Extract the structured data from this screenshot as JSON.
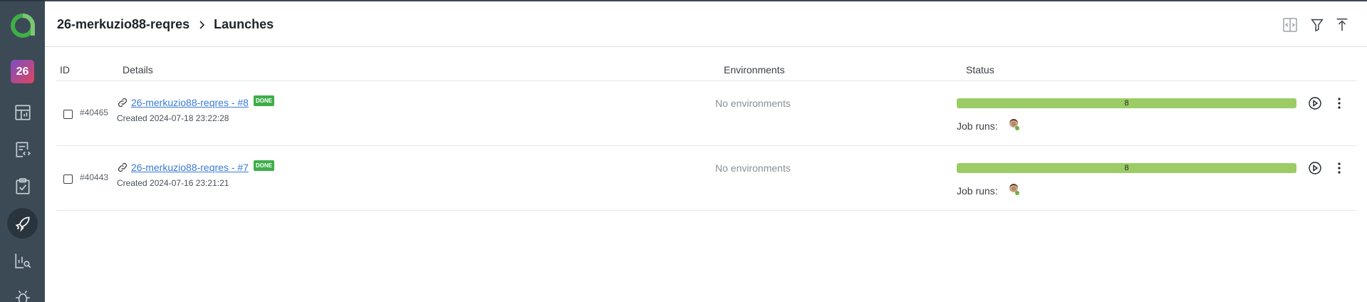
{
  "sidebar": {
    "project_badge": "26",
    "items": [
      {
        "name": "dashboards-icon"
      },
      {
        "name": "test-cases-icon"
      },
      {
        "name": "test-plans-icon"
      },
      {
        "name": "launches-icon",
        "active": true
      },
      {
        "name": "analytics-icon"
      },
      {
        "name": "defects-icon"
      }
    ]
  },
  "header": {
    "project": "26-merkuzio88-reqres",
    "page": "Launches"
  },
  "table": {
    "columns": {
      "id": "ID",
      "details": "Details",
      "environments": "Environments",
      "status": "Status"
    },
    "rows": [
      {
        "id": "#40465",
        "title": "26-merkuzio88-reqres - #8",
        "badge": "DONE",
        "created": "Created 2024-07-18 23:22:28",
        "environments": "No environments",
        "passed": "8",
        "job_runs_label": "Job runs:"
      },
      {
        "id": "#40443",
        "title": "26-merkuzio88-reqres - #7",
        "badge": "DONE",
        "created": "Created 2024-07-16 23:21:21",
        "environments": "No environments",
        "passed": "8",
        "job_runs_label": "Job runs:"
      }
    ]
  },
  "colors": {
    "sidebar_bg": "#3c4a55",
    "passed_bar": "#9ccc65",
    "done_badge": "#3fae49",
    "link": "#3a7bd5"
  }
}
